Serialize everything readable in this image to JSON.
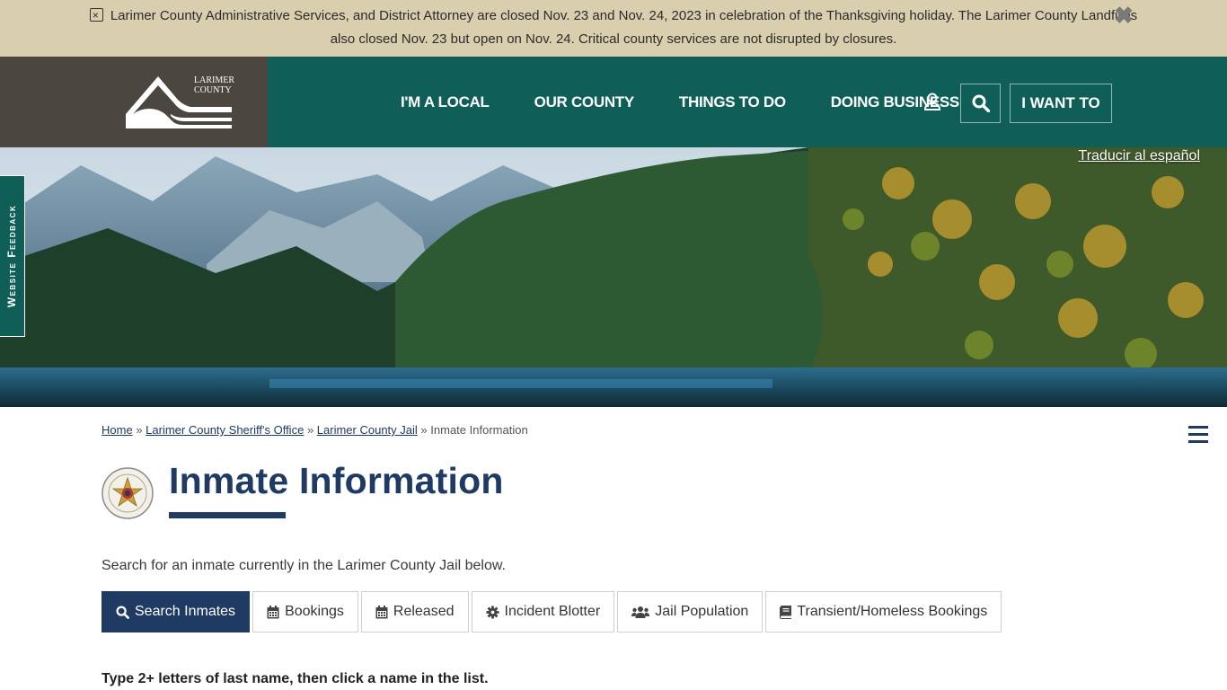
{
  "alert": {
    "line1": "Larimer County Administrative Services, and District Attorney are closed Nov. 23 and Nov. 24, 2023 in celebration of the Thanksgiving holiday. The Larimer County Landfill is",
    "line2": "also closed Nov. 23 but open on Nov. 24. Critical county services are not disrupted by closures.",
    "close_glyph": "✖",
    "icon": "calendar-x-icon"
  },
  "header": {
    "logo_text_line1": "LARIMER",
    "logo_text_line2": "COUNTY",
    "nav": [
      {
        "label": "I'M A LOCAL"
      },
      {
        "label": "OUR COUNTY"
      },
      {
        "label": "THINGS TO DO"
      },
      {
        "label": "DOING BUSINESS"
      }
    ],
    "i_want_to": "I WANT TO",
    "colors": {
      "bar": "#0f5e57",
      "logo_bg": "#4b4640"
    }
  },
  "hero": {
    "translate_link": "Traducir al español",
    "feedback_tab": "Website Feedback"
  },
  "breadcrumb": {
    "items": [
      {
        "label": "Home"
      },
      {
        "label": "Larimer County Sheriff's Office"
      },
      {
        "label": "Larimer County Jail"
      }
    ],
    "separator": "»",
    "current": "Inmate Information"
  },
  "page": {
    "title": "Inmate Information",
    "intro": "Search for an inmate currently in the Larimer County Jail below.",
    "instruction": "Type 2+ letters of last name, then click a name in the list."
  },
  "tabs": [
    {
      "label": "Search Inmates",
      "icon": "search-icon",
      "active": true
    },
    {
      "label": "Bookings",
      "icon": "calendar-icon",
      "active": false
    },
    {
      "label": "Released",
      "icon": "calendar-icon",
      "active": false
    },
    {
      "label": "Incident Blotter",
      "icon": "gear-icon",
      "active": false
    },
    {
      "label": "Jail Population",
      "icon": "users-icon",
      "active": false
    },
    {
      "label": "Transient/Homeless Bookings",
      "icon": "book-icon",
      "active": false
    }
  ],
  "colors": {
    "primary": "#1f3a63",
    "banner": "#d9cfae"
  }
}
